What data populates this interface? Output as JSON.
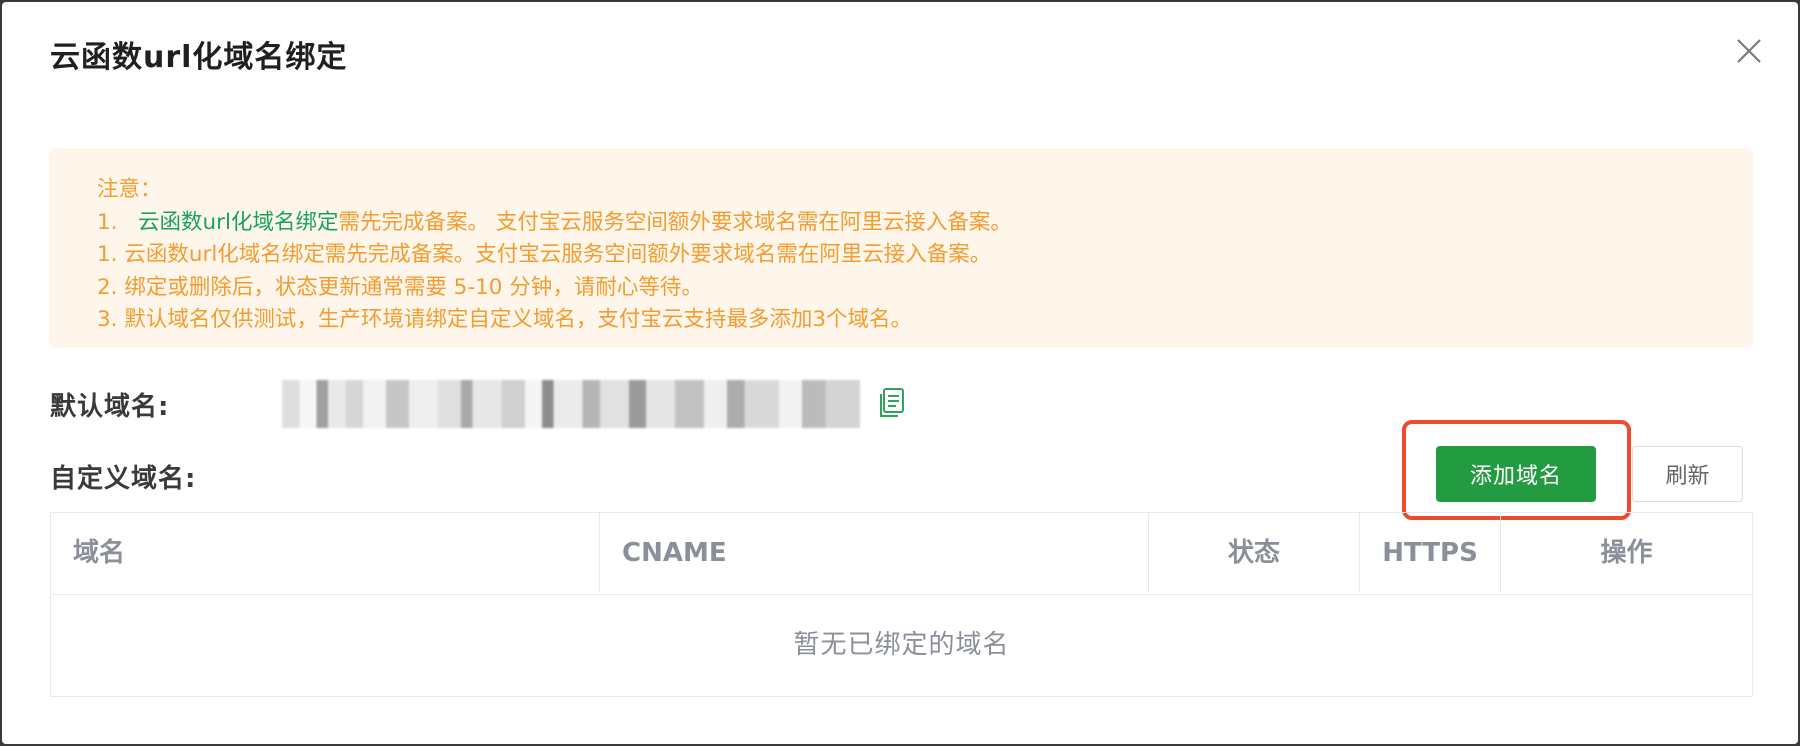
{
  "dialog": {
    "title": "云函数url化域名绑定"
  },
  "notice": {
    "heading": "注意：",
    "line1_prefix": "1.   ",
    "line1_highlight": "云函数url化域名绑定",
    "line1_rest": "需先完成备案。 支付宝云服务空间额外要求域名需在阿里云接入备案。",
    "line2": "1. 云函数url化域名绑定需先完成备案。支付宝云服务空间额外要求域名需在阿里云接入备案。",
    "line3": "2. 绑定或删除后，状态更新通常需要 5-10 分钟，请耐心等待。",
    "line4": "3. 默认域名仅供测试，生产环境请绑定自定义域名，支付宝云支持最多添加3个域名。"
  },
  "default_domain": {
    "label": "默认域名:",
    "copy_icon": "copy-icon"
  },
  "custom_domain": {
    "label": "自定义域名:",
    "add_button": "添加域名",
    "refresh_button": "刷新"
  },
  "table": {
    "columns": [
      "域名",
      "CNAME",
      "状态",
      "HTTPS",
      "操作"
    ],
    "empty_text": "暂无已绑定的域名"
  },
  "colors": {
    "accent_green": "#239b40",
    "notice_text": "#f39c2f",
    "notice_bg": "#fef6eb",
    "highlight_red": "#ee4a2d"
  }
}
